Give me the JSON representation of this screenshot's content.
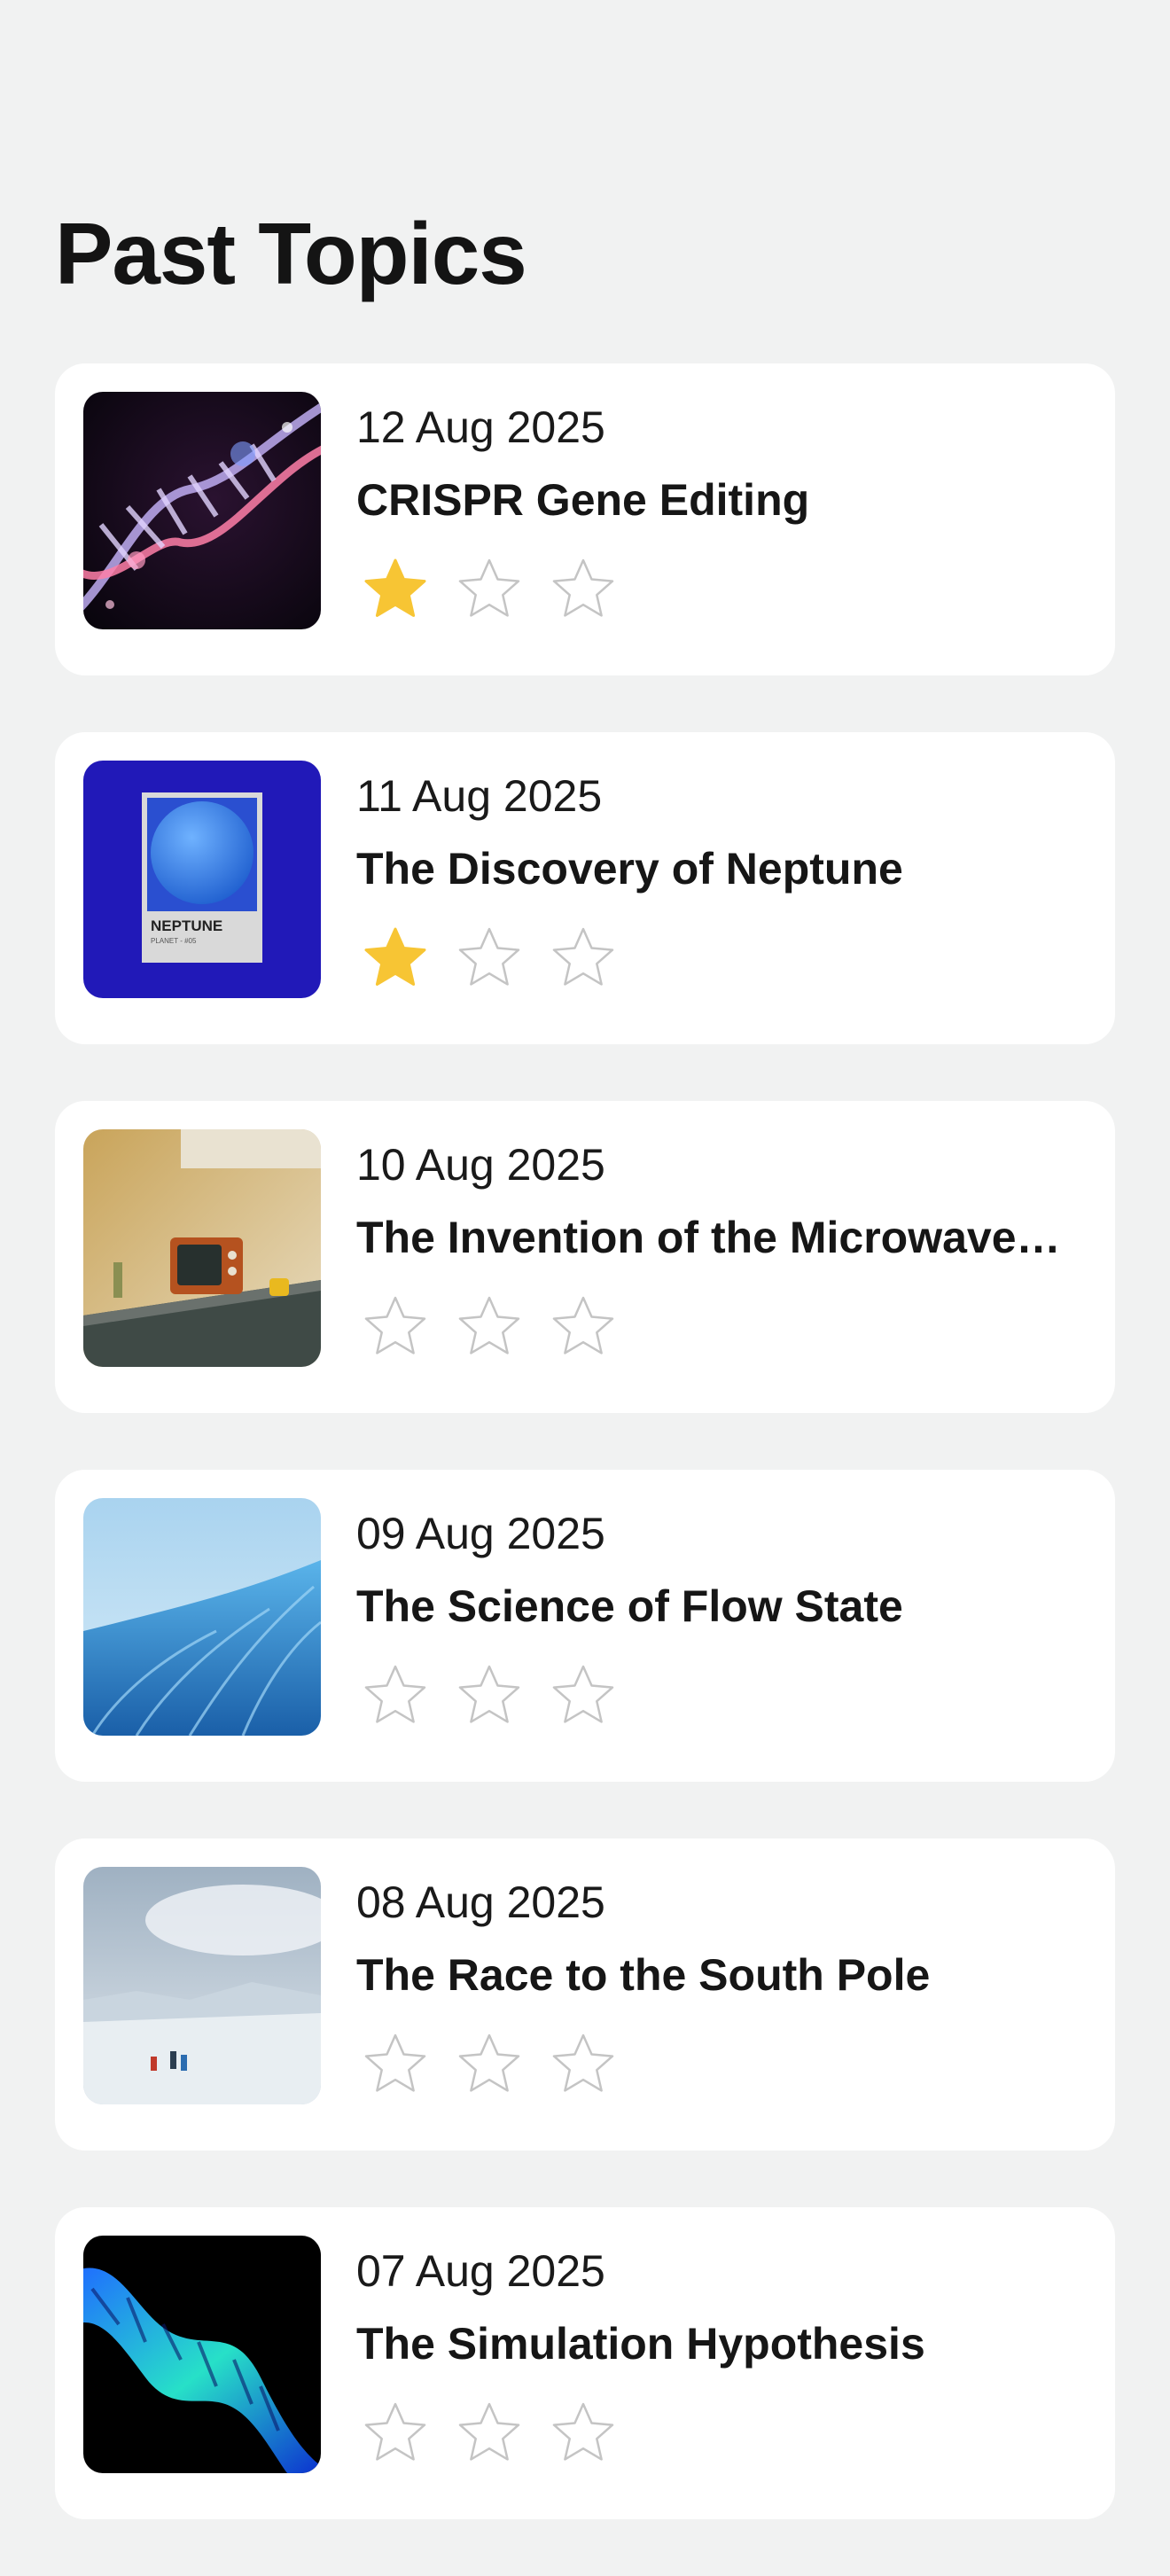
{
  "header": {
    "title": "Past Topics"
  },
  "colors": {
    "background": "#f1f2f2",
    "card": "#ffffff",
    "star_filled": "#f7c534",
    "star_outline": "#c4c4c4"
  },
  "topics": [
    {
      "date": "12 Aug 2025",
      "title": "CRISPR Gene Editing",
      "rating": 1,
      "max_rating": 3,
      "image": "dna-helix-image"
    },
    {
      "date": "11 Aug 2025",
      "title": "The Discovery of Neptune",
      "rating": 1,
      "max_rating": 3,
      "image": "neptune-swatch-image",
      "image_text": {
        "name": "NEPTUNE",
        "caption": "PLANET - #05"
      }
    },
    {
      "date": "10 Aug 2025",
      "title": "The Invention of the Microwave…",
      "rating": 0,
      "max_rating": 3,
      "image": "kitchen-tv-image"
    },
    {
      "date": "09 Aug 2025",
      "title": "The Science of Flow State",
      "rating": 0,
      "max_rating": 3,
      "image": "water-flow-image"
    },
    {
      "date": "08 Aug 2025",
      "title": "The Race to the South Pole",
      "rating": 0,
      "max_rating": 3,
      "image": "polar-expedition-image"
    },
    {
      "date": "07 Aug 2025",
      "title": "The Simulation Hypothesis",
      "rating": 0,
      "max_rating": 3,
      "image": "abstract-twist-image"
    }
  ]
}
